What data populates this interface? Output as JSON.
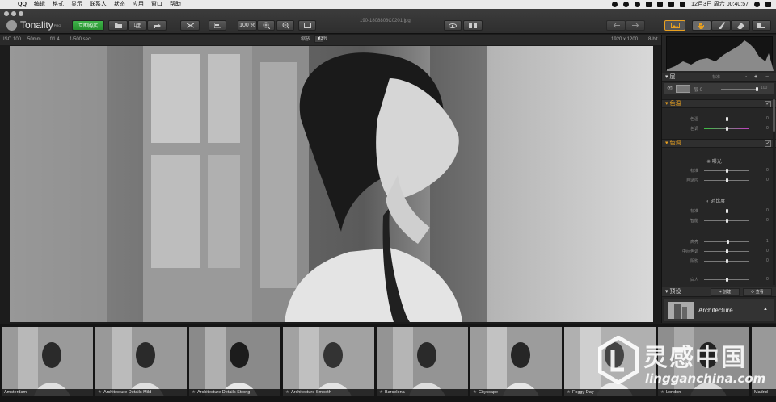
{
  "menubar": {
    "app_name": "QQ",
    "items": [
      "编辑",
      "格式",
      "显示",
      "联系人",
      "状态",
      "应用",
      "窗口",
      "帮助"
    ],
    "clock": "12月3日 周六 00:40:57"
  },
  "window": {
    "filename": "190-1808808C0201.jpg"
  },
  "toolbar": {
    "logo": "Tonality",
    "logo_sup": "PRO",
    "buy_label": "立即购买",
    "zoom_value": "100 %"
  },
  "infobar": {
    "iso": "ISO 100",
    "focal": "50mm",
    "aperture": "f/1.4",
    "shutter": "1/500 sec",
    "zoom_label": "缩放",
    "zoom_value": "83%",
    "dimensions": "1920 x 1200",
    "bitdepth": "8-bit"
  },
  "panel": {
    "layers": {
      "title": "层",
      "blend_mode": "标准",
      "layer_name": "层 0",
      "opacity": "100"
    },
    "color_section": {
      "title": "色温",
      "rows": [
        {
          "label": "色温",
          "value": "0"
        },
        {
          "label": "色调",
          "value": "0"
        }
      ]
    },
    "tone_section": {
      "title": "色调",
      "exposure": {
        "title": "曝光",
        "rows": [
          {
            "label": "标准",
            "value": "0"
          },
          {
            "label": "自适应",
            "value": "0"
          }
        ]
      },
      "contrast": {
        "title": "对比度",
        "rows": [
          {
            "label": "标准",
            "value": "0"
          },
          {
            "label": "智能",
            "value": "0"
          }
        ]
      },
      "tone_rows": [
        {
          "label": "高亮",
          "value": "+1"
        },
        {
          "label": "中间色调",
          "value": "0"
        },
        {
          "label": "阴影",
          "value": "0"
        }
      ],
      "whites": {
        "label": "白人",
        "value": "0"
      }
    },
    "presets": {
      "title": "预设",
      "create_label": "创建",
      "manage_label": "查看",
      "current": "Architecture"
    }
  },
  "filmstrip": {
    "presets": [
      "Amsterdam",
      "Architecture Details Mild",
      "Architecture Details Strong",
      "Architecture Smooth",
      "Barcelona",
      "Cityscape",
      "Foggy Day",
      "London",
      "Madrid"
    ]
  },
  "watermark": {
    "brand": "灵感中国",
    "url": "lingganchina.com"
  },
  "colors": {
    "accent": "#e8a020",
    "buy": "#2fa33b",
    "panel": "#262626"
  }
}
